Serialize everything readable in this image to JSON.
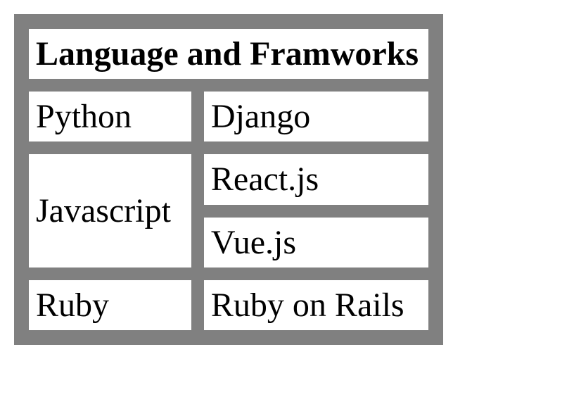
{
  "table": {
    "header": "Language and Framworks",
    "rows": [
      {
        "language": "Python",
        "framework": "Django"
      },
      {
        "language": "Javascript",
        "framework": "React.js"
      },
      {
        "language": "",
        "framework": "Vue.js"
      },
      {
        "language": "Ruby",
        "framework": "Ruby on Rails"
      }
    ]
  }
}
